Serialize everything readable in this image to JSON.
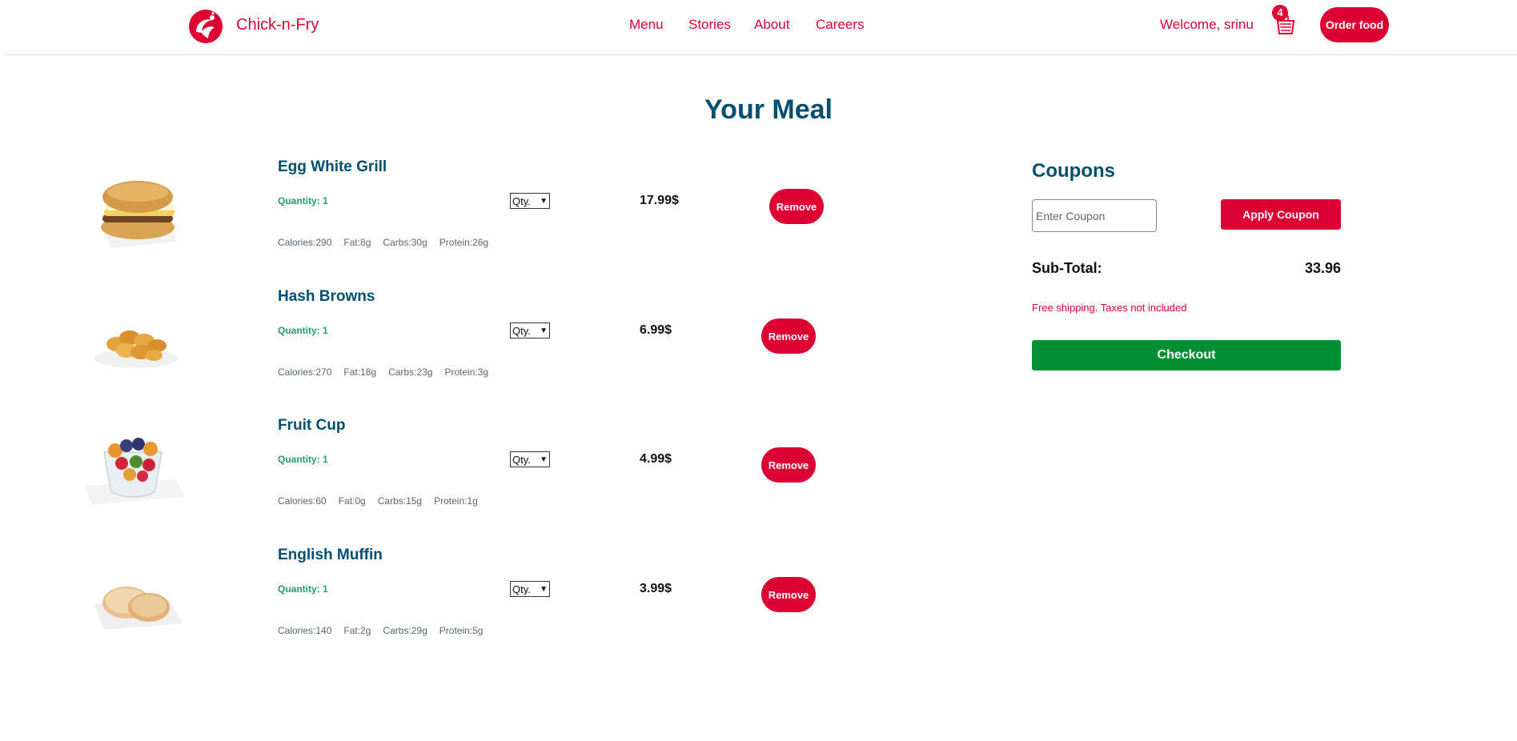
{
  "header": {
    "brand": "Chick-n-Fry",
    "logo_icon": "chicken-logo-icon",
    "nav": [
      "Menu",
      "Stories",
      "About",
      "Careers"
    ],
    "welcome": "Welcome, srinu",
    "cart_icon": "shopping-bag-icon",
    "cart_count": "4",
    "order_button": "Order food"
  },
  "page_title": "Your Meal",
  "items": [
    {
      "name": "Egg White Grill",
      "quantity": "Quantity: 1",
      "qty_select": "Qty.",
      "price": "17.99$",
      "remove": "Remove",
      "calories": "Calories:290",
      "fat": "Fat:8g",
      "carbs": "Carbs:30g",
      "protein": "Protein:26g",
      "image": "egg-white-grill-sandwich"
    },
    {
      "name": "Hash Browns",
      "quantity": "Quantity: 1",
      "qty_select": "Qty.",
      "price": "6.99$",
      "remove": "Remove",
      "calories": "Calories:270",
      "fat": "Fat:18g",
      "carbs": "Carbs:23g",
      "protein": "Protein:3g",
      "image": "hash-browns"
    },
    {
      "name": "Fruit Cup",
      "quantity": "Quantity: 1",
      "qty_select": "Qty.",
      "price": "4.99$",
      "remove": "Remove",
      "calories": "Calories:60",
      "fat": "Fat:0g",
      "carbs": "Carbs:15g",
      "protein": "Protein:1g",
      "image": "fruit-cup"
    },
    {
      "name": "English Muffin",
      "quantity": "Quantity: 1",
      "qty_select": "Qty.",
      "price": "3.99$",
      "remove": "Remove",
      "calories": "Calories:140",
      "fat": "Fat:2g",
      "carbs": "Carbs:29g",
      "protein": "Protein:5g",
      "image": "english-muffin"
    }
  ],
  "coupons": {
    "title": "Coupons",
    "placeholder": "Enter Coupon",
    "apply_button": "Apply Coupon",
    "subtotal_label": "Sub-Total:",
    "subtotal_value": "33.96",
    "shipping_note": "Free shipping. Taxes not included",
    "checkout_button": "Checkout"
  },
  "colors": {
    "brand_red": "#dd0033",
    "navy": "#004f71",
    "green": "#009033",
    "quantity_green": "#249e6b"
  }
}
